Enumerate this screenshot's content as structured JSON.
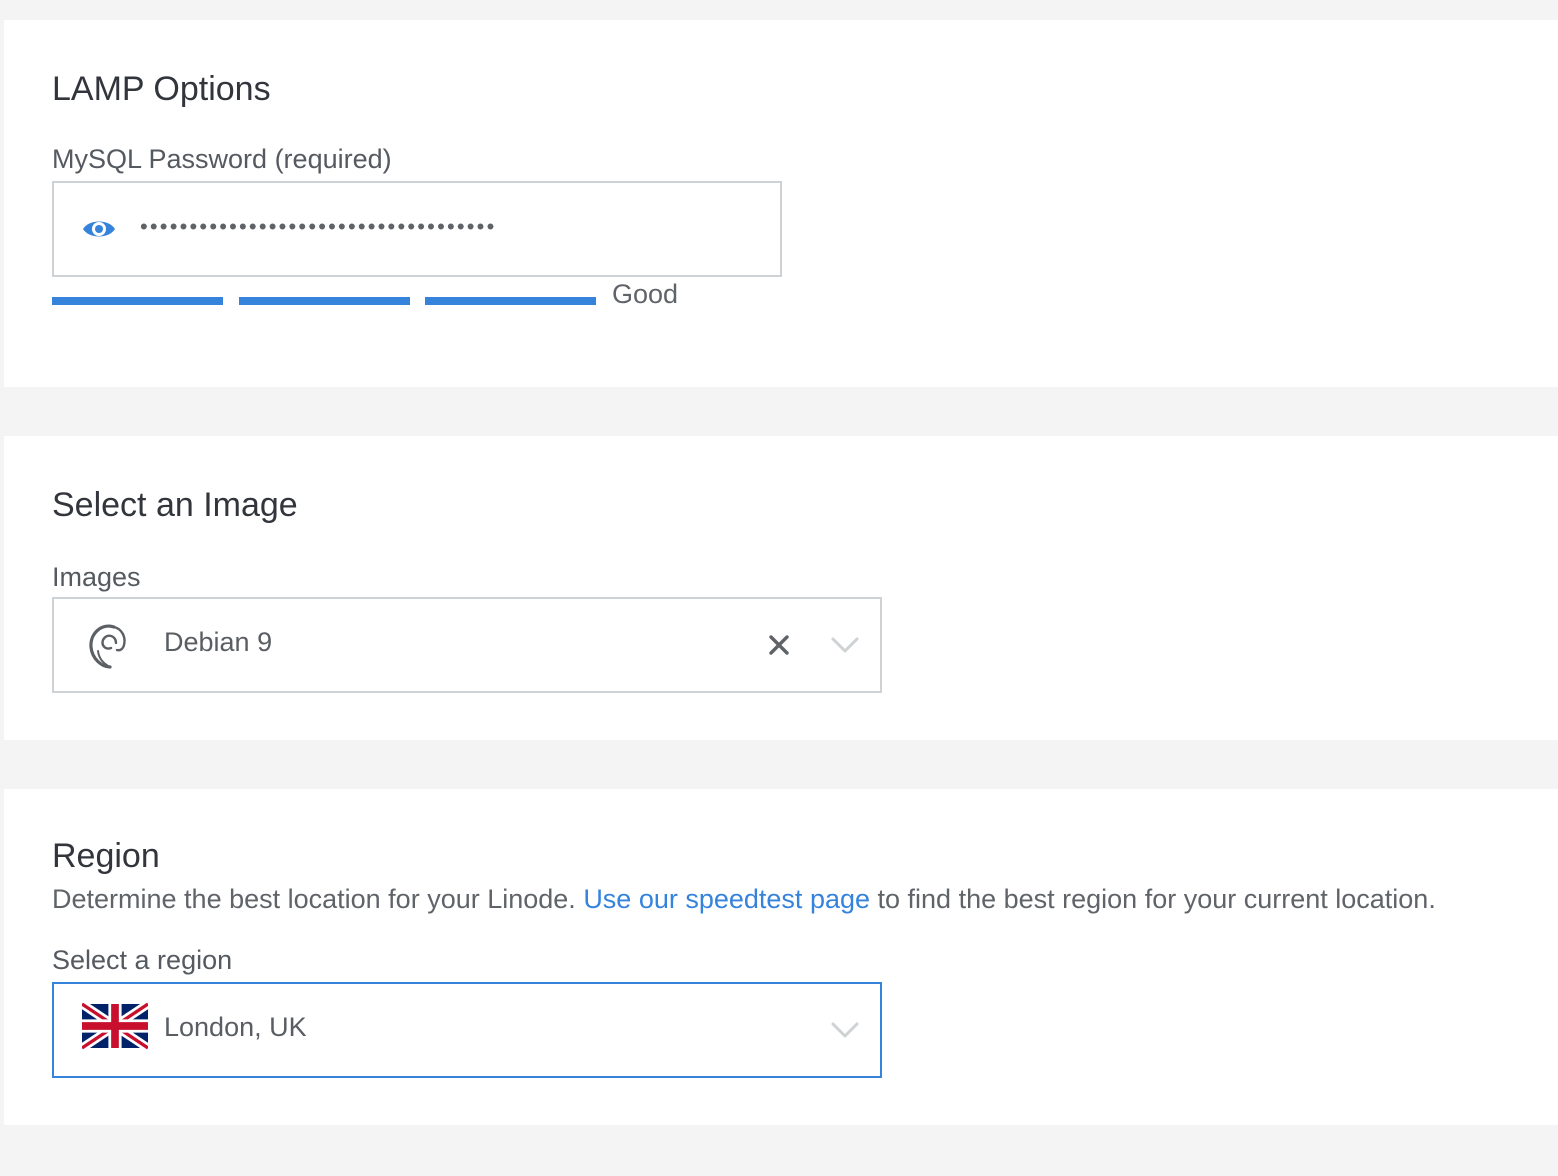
{
  "lamp_options": {
    "title": "LAMP Options",
    "password_label": "MySQL Password (required)",
    "password_masked": "••••••••••••••••••••••••••••••••••••",
    "strength_text": "Good",
    "strength_segments_filled": 3,
    "strength_segments_total": 3
  },
  "image_section": {
    "title": "Select an Image",
    "images_label": "Images",
    "selected_image": "Debian 9",
    "image_icon": "debian-swirl-icon"
  },
  "region_section": {
    "title": "Region",
    "description_prefix": "Determine the best location for your Linode. ",
    "speedtest_link_text": "Use our speedtest page",
    "description_suffix": " to find the best region for your current location.",
    "select_label": "Select a region",
    "selected_region": "London, UK",
    "region_icon": "uk-flag-icon"
  },
  "colors": {
    "accent": "#3683dc",
    "background": "#f4f4f4",
    "panel": "#ffffff",
    "border": "#cfd2d4"
  }
}
